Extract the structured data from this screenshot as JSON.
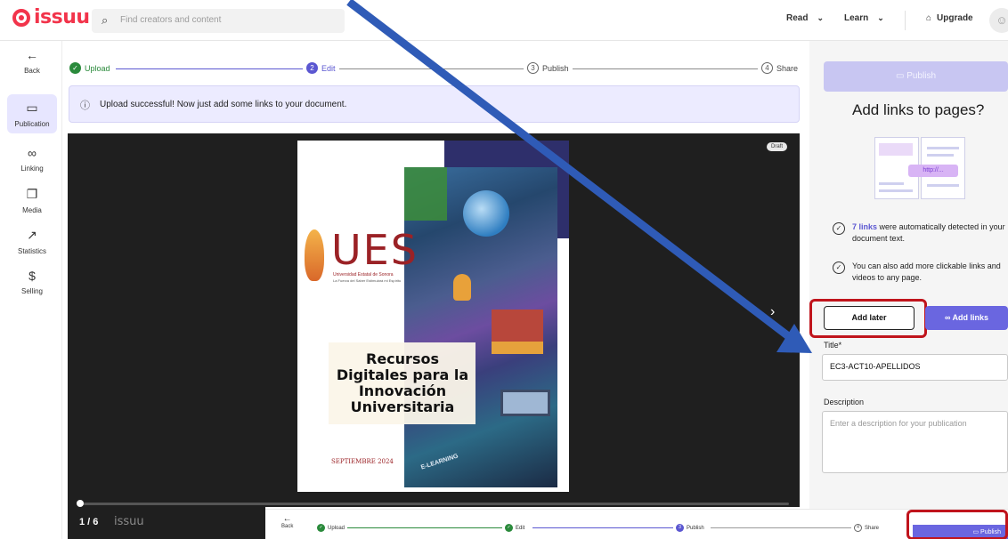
{
  "header": {
    "logo_text": "issuu",
    "search_placeholder": "Find creators and content",
    "nav_read": "Read",
    "nav_learn": "Learn",
    "upgrade_label": "Upgrade"
  },
  "sidebar": {
    "back_label": "Back",
    "items": [
      {
        "label": "Publication",
        "icon": "book-icon"
      },
      {
        "label": "Linking",
        "icon": "link-icon"
      },
      {
        "label": "Media",
        "icon": "media-icon"
      },
      {
        "label": "Statistics",
        "icon": "trend-icon"
      },
      {
        "label": "Selling",
        "icon": "dollar-icon"
      }
    ]
  },
  "stepper": {
    "steps": [
      {
        "label": "Upload",
        "marker": "✓"
      },
      {
        "label": "Edit",
        "marker": "2"
      },
      {
        "label": "Publish",
        "marker": "3"
      },
      {
        "label": "Share",
        "marker": "4"
      }
    ]
  },
  "alert": {
    "text": "Upload successful! Now just add some links to your document."
  },
  "preview": {
    "badge": "Draft",
    "page_counter": "1 / 6",
    "footer_logo": "issuu",
    "progress": 0.0
  },
  "document": {
    "logo_text": "UES",
    "university": "Universidad Estatal de Sonora",
    "motto": "La Fuerza del Saber Estimulará mi Espíritu",
    "title": "Recursos Digitales para la Innovación Universitaria",
    "date": "SEPTIEMBRE 2024",
    "badge": "E-LEARNING"
  },
  "right_panel": {
    "publish_label": "Publish",
    "title": "Add links to pages?",
    "illustration_link": "http://...",
    "detected_count": "7 links",
    "detected_text": " were automatically detected in your document text.",
    "more_text": "You can also add more clickable links and videos to any page.",
    "add_later_label": "Add later",
    "add_links_label": "Add links",
    "title_field_label": "Title*",
    "title_field_value": "EC3-ACT10-APELLIDOS",
    "description_label": "Description",
    "description_placeholder": "Enter a description for your publication"
  },
  "overlay": {
    "back_label": "Back",
    "steps": [
      "Upload",
      "Edit",
      "Publish",
      "Share"
    ],
    "publish_label": "Publish"
  },
  "colors": {
    "brand": "#f2344b",
    "accent": "#6a66e0",
    "success": "#2a8a3b",
    "highlight": "#c0141c",
    "arrow": "#2f5bb7"
  }
}
